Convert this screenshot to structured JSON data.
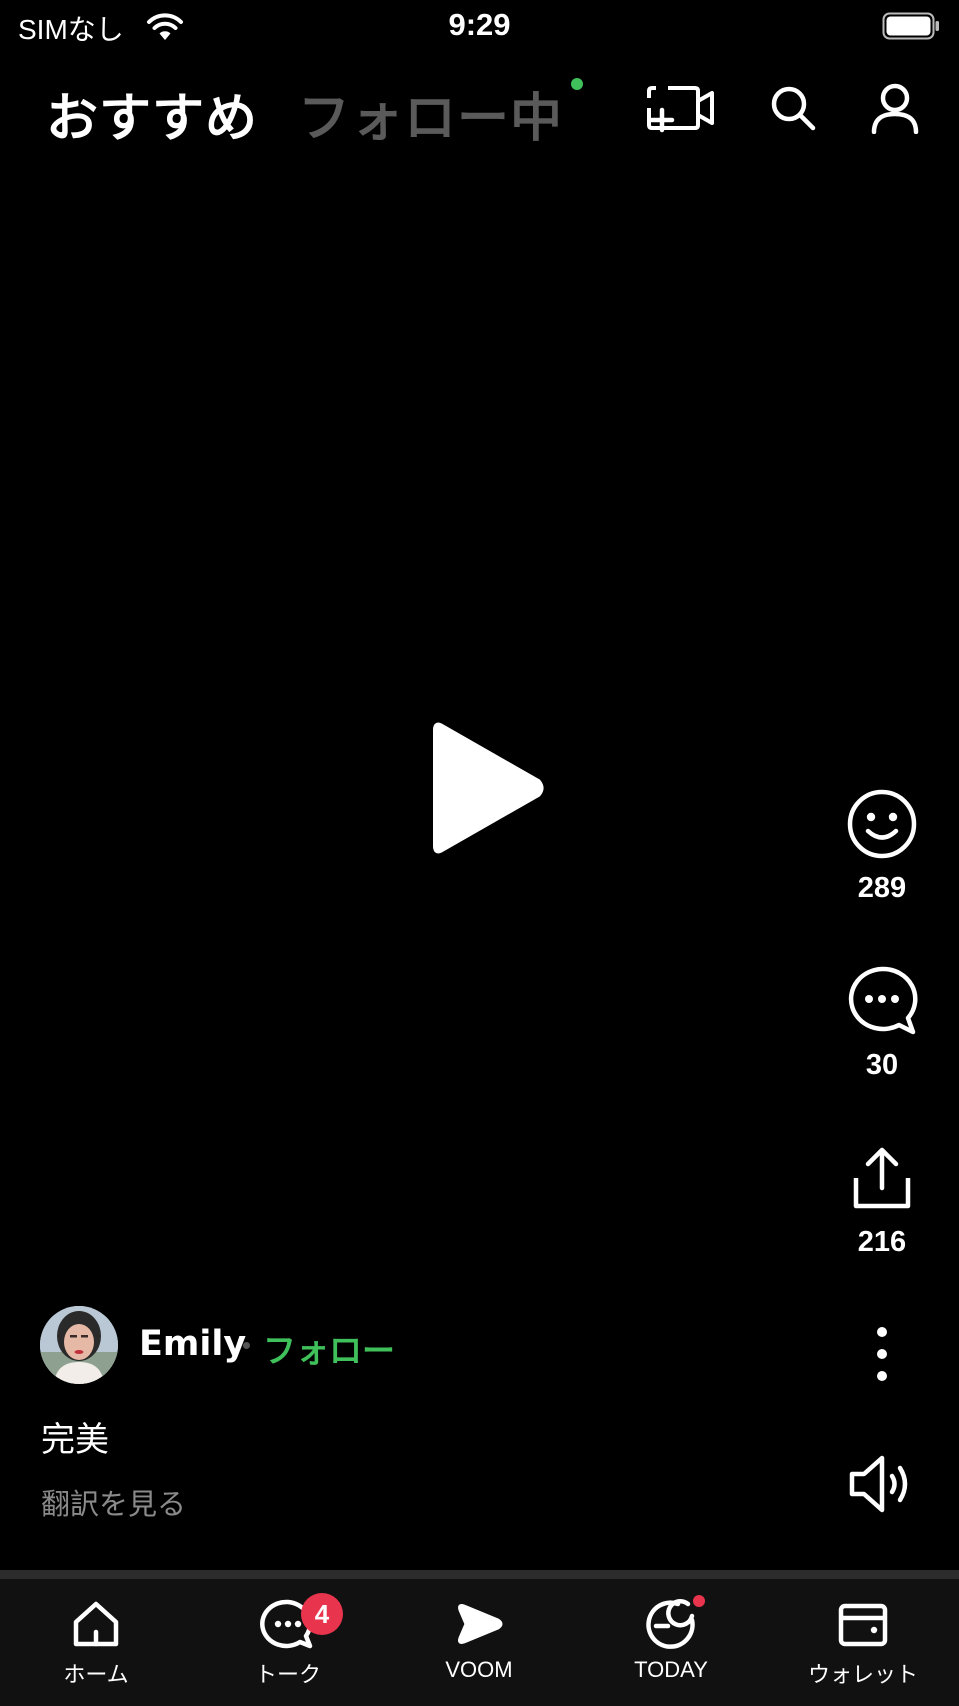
{
  "status_bar": {
    "carrier": "SIMなし",
    "time": "9:29"
  },
  "header": {
    "tabs": [
      {
        "label": "おすすめ",
        "active": true
      },
      {
        "label": "フォロー中",
        "active": false,
        "has_new_dot": true
      }
    ],
    "icons": [
      "video-add-icon",
      "search-icon",
      "profile-icon"
    ]
  },
  "video": {
    "state": "paused",
    "icon": "play-icon"
  },
  "actions": {
    "reactions_count": "289",
    "comments_count": "30",
    "shares_count": "216"
  },
  "post": {
    "author": "Emily",
    "follow_label": "フォロー",
    "caption": "完美",
    "translate_label": "翻訳を見る"
  },
  "bottom_nav": [
    {
      "label": "ホーム",
      "icon": "home-icon"
    },
    {
      "label": "トーク",
      "icon": "chat-icon",
      "badge": "4"
    },
    {
      "label": "VOOM",
      "icon": "voom-icon",
      "active": true
    },
    {
      "label": "TODAY",
      "icon": "today-icon",
      "has_dot": true
    },
    {
      "label": "ウォレット",
      "icon": "wallet-icon"
    }
  ],
  "colors": {
    "background": "#000000",
    "accent_green": "#3fc05a",
    "badge_red": "#e8344d",
    "inactive_tab": "#5a5a5a",
    "nav_background": "#111111"
  }
}
